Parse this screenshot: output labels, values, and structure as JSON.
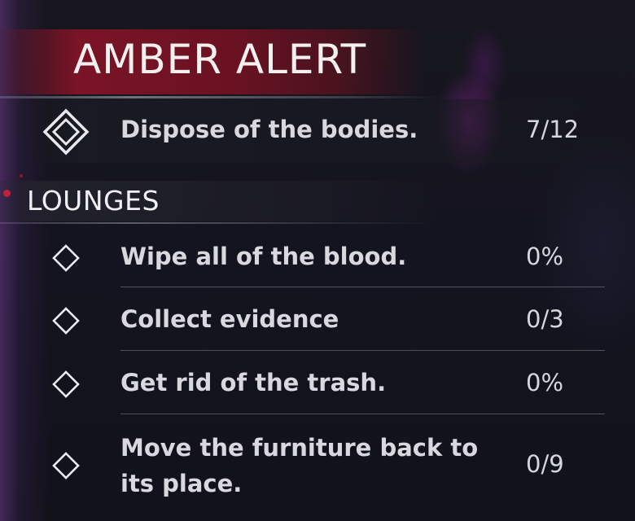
{
  "header": {
    "title": "AMBER ALERT"
  },
  "main_objective": {
    "label": "Dispose of the bodies.",
    "count": "7/12",
    "icon": "double-diamond-icon"
  },
  "section": {
    "title": "LOUNGES"
  },
  "objectives": [
    {
      "label": "Wipe all of the blood.",
      "count": "0%",
      "icon": "diamond-outline-icon"
    },
    {
      "label": "Collect evidence",
      "count": "0/3",
      "icon": "diamond-outline-icon"
    },
    {
      "label": "Get rid of the trash.",
      "count": "0%",
      "icon": "diamond-outline-icon"
    },
    {
      "label": "Move the furniture back to its place.",
      "count": "0/9",
      "icon": "diamond-outline-icon"
    }
  ],
  "colors": {
    "header_red": "#7a1426",
    "accent_dot": "#c0203a",
    "text": "#d8d8de"
  }
}
